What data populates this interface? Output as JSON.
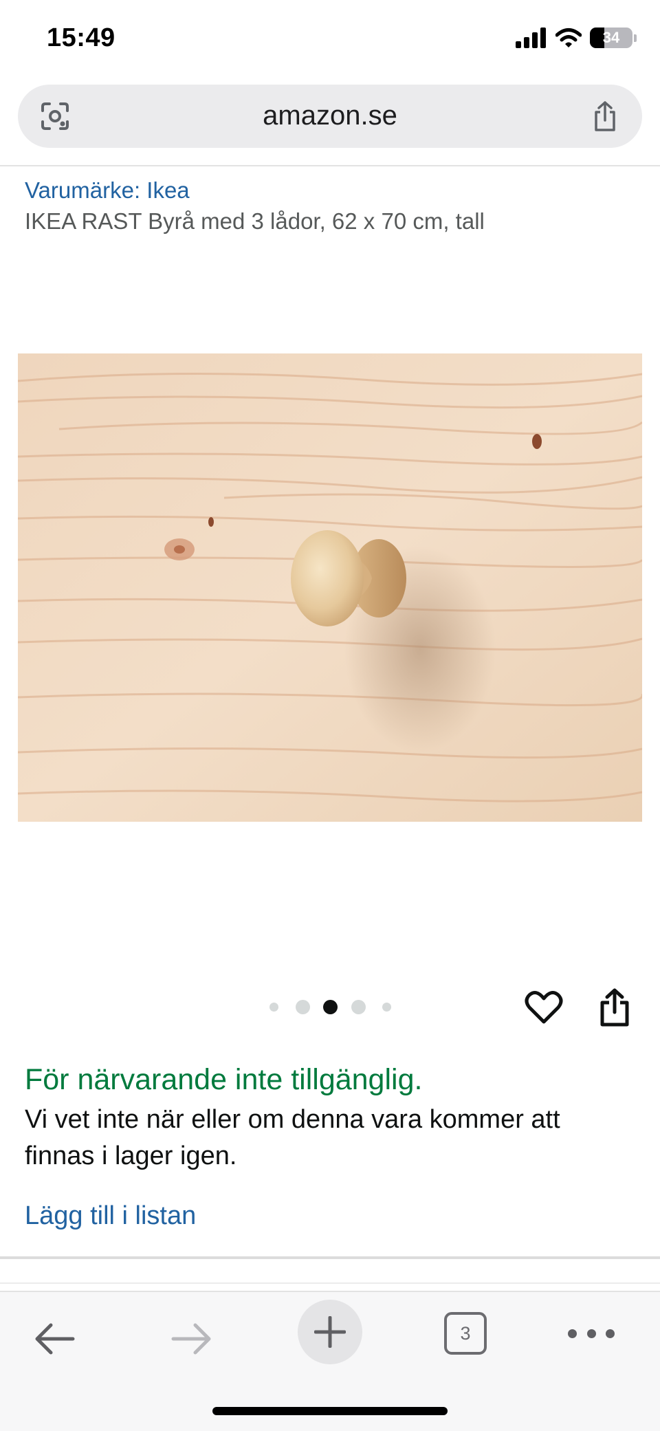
{
  "status_bar": {
    "time": "15:49",
    "battery_level": "34",
    "icons": [
      "signal-icon",
      "wifi-icon",
      "battery-icon"
    ]
  },
  "browser": {
    "url": "amazon.se",
    "icons": [
      "lens-icon",
      "share-icon"
    ]
  },
  "product": {
    "brand": "Varumärke: Ikea",
    "title": "IKEA RAST Byrå med 3 lådor, 62 x 70 cm, tall",
    "image_subject": "pine-drawer-knob"
  },
  "carousel": {
    "total_images": 5,
    "active_index": 2
  },
  "availability": {
    "status": "För närvarande inte tillgänglig.",
    "note": "Vi vet inte när eller om denna vara kommer att finnas i lager igen.",
    "add_to_list": "Lägg till i listan"
  },
  "toolbar": {
    "tab_count": "3",
    "icons": [
      "back-arrow-icon",
      "forward-arrow-icon",
      "plus-icon",
      "tabs-icon",
      "more-icon"
    ]
  },
  "colors": {
    "link": "#2162a1",
    "availability": "#007a3d",
    "text": "#0f1111",
    "secondary_text": "#565959"
  }
}
